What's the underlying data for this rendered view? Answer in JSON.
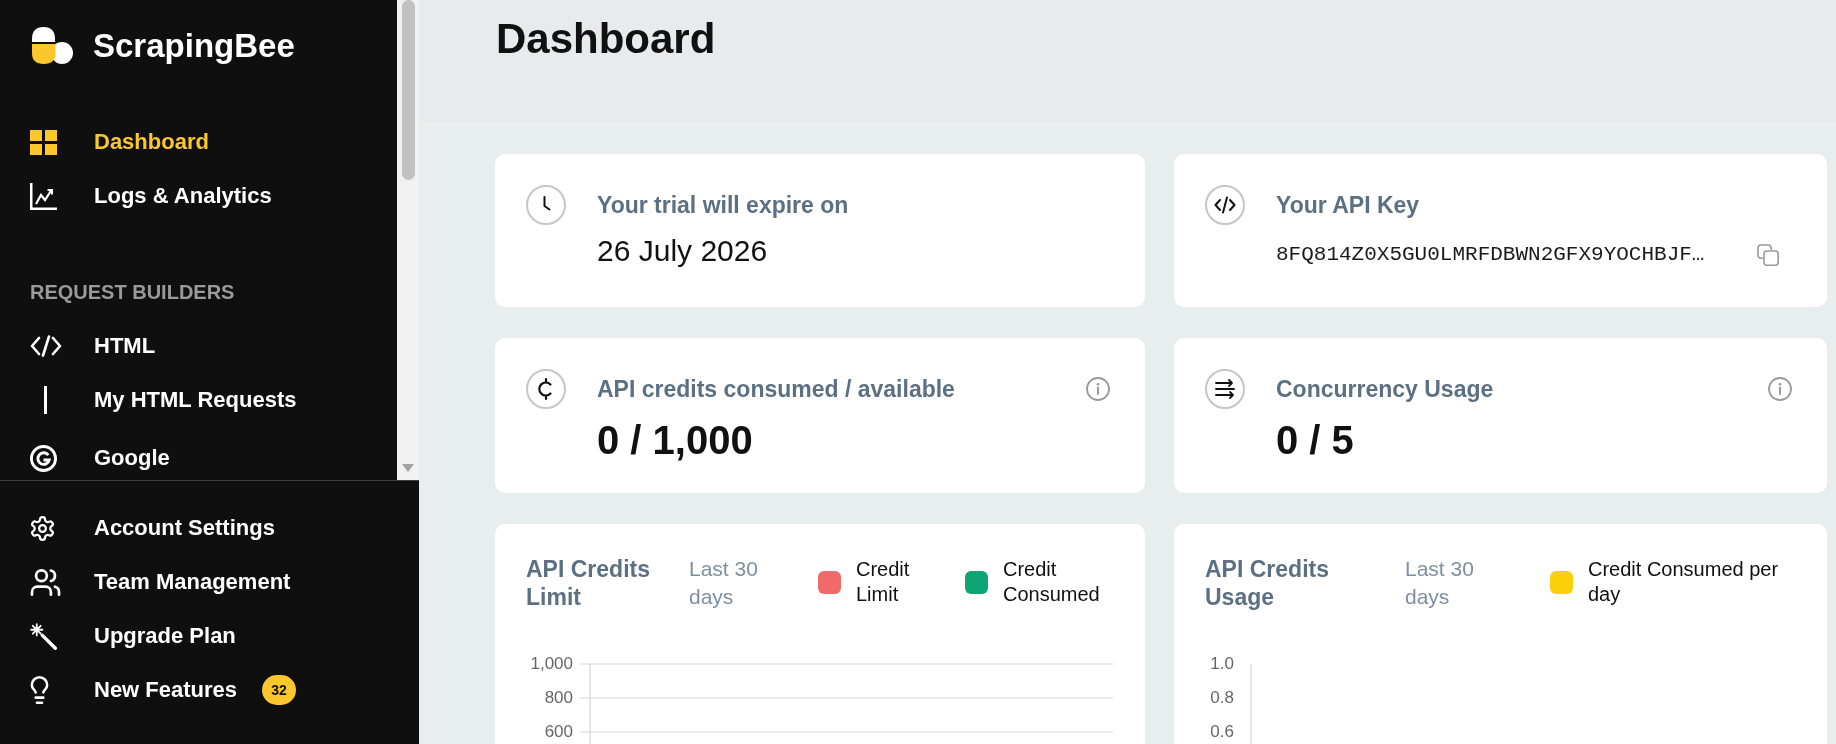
{
  "sidebar": {
    "brand": "ScrapingBee",
    "nav": [
      {
        "label": "Dashboard",
        "selected": true
      },
      {
        "label": "Logs & Analytics",
        "selected": false
      }
    ],
    "section_title": "REQUEST BUILDERS",
    "builders": [
      {
        "label": "HTML",
        "selected": false,
        "children": [
          {
            "label": "My HTML Requests",
            "selected": false
          }
        ]
      },
      {
        "label": "Google",
        "selected": false
      }
    ],
    "footer_nav": [
      {
        "label": "Account Settings",
        "selected": false
      },
      {
        "label": "Team Management",
        "selected": false
      },
      {
        "label": "Upgrade Plan",
        "selected": false
      },
      {
        "label": "New Features",
        "selected": false,
        "badge": "32"
      }
    ]
  },
  "header": {
    "title": "Dashboard"
  },
  "cards": [
    {
      "kind": "date",
      "title": "Your trial will expire on",
      "value": "26 July 2026"
    },
    {
      "kind": "key",
      "title": "Your API Key",
      "value": "8FQ814Z0X5GU0LMRFDBWN2GFX9YOCHBJF…"
    },
    {
      "kind": "stat",
      "title": "API credits consumed / available",
      "value": "0 / 1,000"
    },
    {
      "kind": "stat",
      "title": "Concurrency Usage",
      "value": "0 / 5"
    }
  ],
  "charts": [
    {
      "title": "API Credits Limit",
      "period": "Last 30 days",
      "gridlines": true,
      "legend": [
        {
          "label": "Credit Limit",
          "color": "#f06a6a"
        },
        {
          "label": "Credit Consumed",
          "color": "#0ea575"
        }
      ],
      "y_tick_labels": [
        "1,000",
        "800",
        "600"
      ]
    },
    {
      "title": "API Credits Usage",
      "period": "Last 30 days",
      "gridlines": false,
      "legend": [
        {
          "label": "Credit Consumed per day",
          "color": "#fccf0b"
        }
      ],
      "y_tick_labels": [
        "1.0",
        "0.8",
        "0.6"
      ]
    }
  ]
}
